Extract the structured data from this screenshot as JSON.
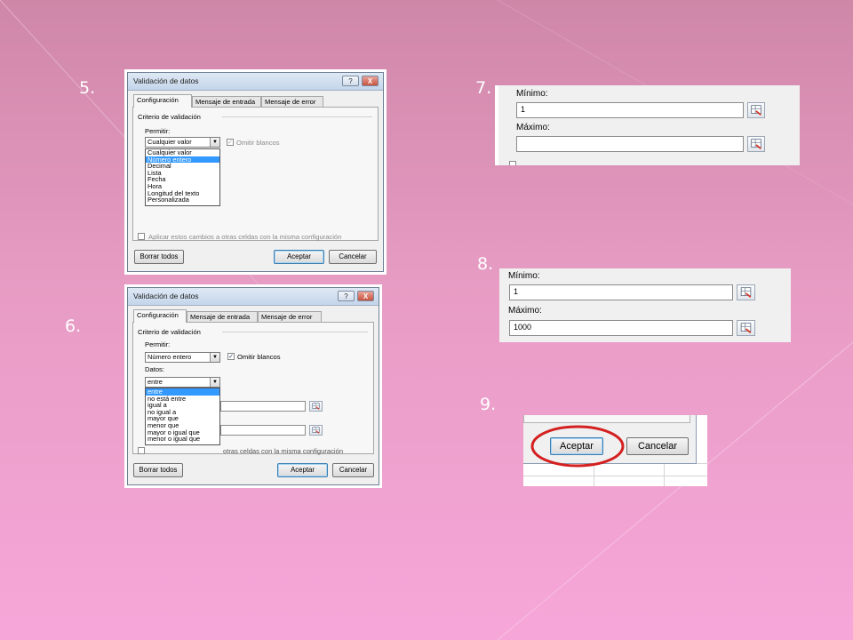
{
  "steps": {
    "s5": "5.",
    "s6": "6.",
    "s7": "7.",
    "s8": "8.",
    "s9": "9."
  },
  "dialog5": {
    "title": "Validación de datos",
    "help_button": "?",
    "close_button": "X",
    "tabs": [
      "Configuración",
      "Mensaje de entrada",
      "Mensaje de error"
    ],
    "group_label": "Criterio de validación",
    "allow_label": "Permitir:",
    "allow_value": "Cualquier valor",
    "ignore_blank_label": "Omitir blancos",
    "allow_options": [
      "Cualquier valor",
      "Número entero",
      "Decimal",
      "Lista",
      "Fecha",
      "Hora",
      "Longitud del texto",
      "Personalizada"
    ],
    "apply_label": "Aplicar estos cambios a otras celdas con la misma configuración",
    "clear_all": "Borrar todos",
    "ok": "Aceptar",
    "cancel": "Cancelar"
  },
  "dialog6": {
    "title": "Validación de datos",
    "help_button": "?",
    "close_button": "X",
    "tabs": [
      "Configuración",
      "Mensaje de entrada",
      "Mensaje de error"
    ],
    "group_label": "Criterio de validación",
    "allow_label": "Permitir:",
    "allow_value": "Número entero",
    "ignore_blank_label": "Omitir blancos",
    "data_label": "Datos:",
    "data_value": "entre",
    "data_options": [
      "entre",
      "no está entre",
      "igual a",
      "no igual a",
      "mayor que",
      "menor que",
      "mayor o igual que",
      "menor o igual que"
    ],
    "apply_partial": "otras celdas con la misma configuración",
    "clear_all": "Borrar todos",
    "ok": "Aceptar",
    "cancel": "Cancelar"
  },
  "panel7": {
    "min_label": "Mínimo:",
    "min_value": "1",
    "max_label": "Máximo:",
    "max_value": ""
  },
  "panel8": {
    "min_label": "Mínimo:",
    "min_value": "1",
    "max_label": "Máximo:",
    "max_value": "1000"
  },
  "panel9": {
    "ok": "Aceptar",
    "cancel": "Cancelar",
    "highlight_color": "#d42020"
  },
  "icons": {
    "range_picker": "range-picker-icon",
    "checkbox": "checkbox-check-icon",
    "dropdown": "dropdown-arrow-icon"
  }
}
